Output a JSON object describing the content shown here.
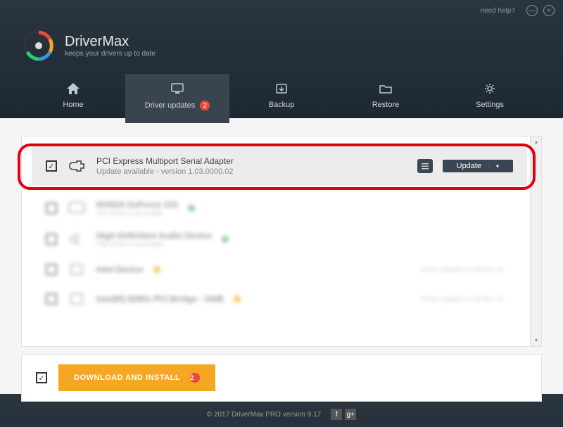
{
  "window": {
    "help_label": "need help?",
    "minimize": "—",
    "close": "×"
  },
  "brand": {
    "title": "DriverMax",
    "subtitle": "keeps your drivers up to date"
  },
  "tabs": {
    "home": "Home",
    "updates": "Driver updates",
    "updates_badge": "2",
    "backup": "Backup",
    "restore": "Restore",
    "settings": "Settings"
  },
  "featured": {
    "name": "PCI Express Multiport Serial Adapter",
    "sub": "Update available - version 1.03.0000.02",
    "update_btn": "Update"
  },
  "rows": [
    {
      "name": "NVIDIA GeForce 210",
      "sub": "This driver is up-to-date",
      "dot": "green",
      "status": ""
    },
    {
      "name": "High Definition Audio Device",
      "sub": "This driver is up-to-date",
      "dot": "green",
      "status": ""
    },
    {
      "name": "Intel Device",
      "sub": "",
      "dot": "orange",
      "status": "Driver updated on 03-Nov-16"
    },
    {
      "name": "Intel(R) 82801 PCI Bridge - 244E",
      "sub": "",
      "dot": "orange",
      "status": "Driver updated on 03-Nov-16"
    }
  ],
  "footer": {
    "download_label": "DOWNLOAD AND INSTALL",
    "download_badge": "2"
  },
  "bottom": {
    "copyright": "© 2017 DriverMax PRO version 9.17"
  }
}
